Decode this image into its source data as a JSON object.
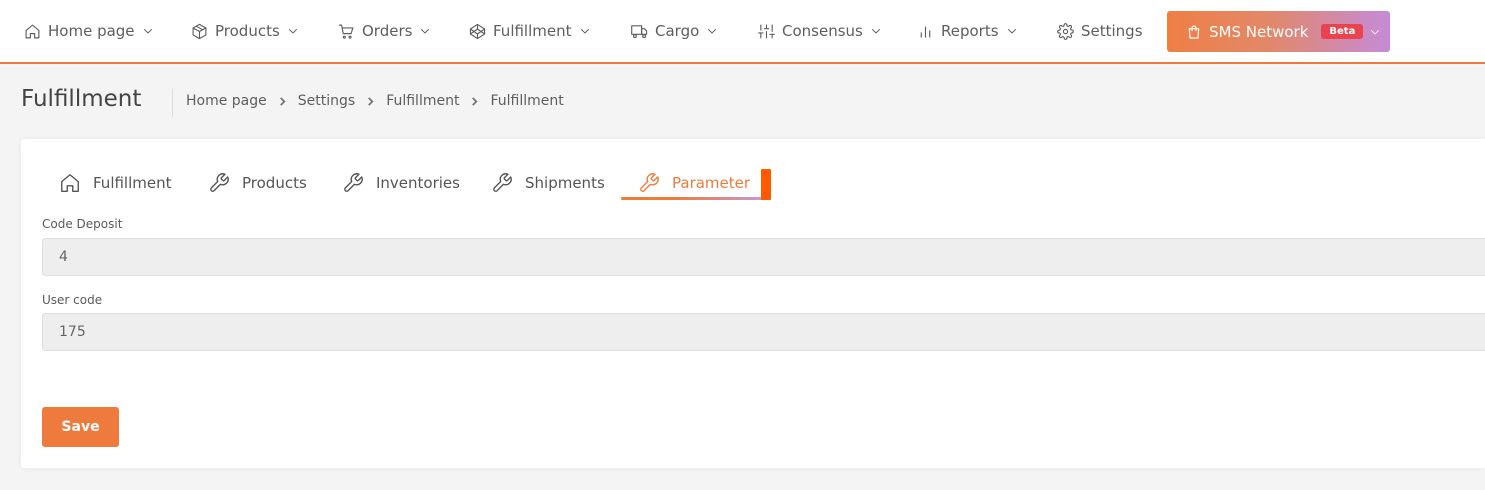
{
  "nav": {
    "items": [
      {
        "label": "Home page",
        "icon": "home-icon"
      },
      {
        "label": "Products",
        "icon": "box-icon"
      },
      {
        "label": "Orders",
        "icon": "cart-icon"
      },
      {
        "label": "Fulfillment",
        "icon": "codepen-icon"
      },
      {
        "label": "Cargo",
        "icon": "truck-icon"
      },
      {
        "label": "Consensus",
        "icon": "sliders-icon"
      },
      {
        "label": "Reports",
        "icon": "bar-chart-icon"
      },
      {
        "label": "Settings",
        "icon": "gear-icon"
      }
    ],
    "sms": {
      "label": "SMS Network",
      "badge": "Beta",
      "icon": "shopping-bag-icon"
    }
  },
  "page": {
    "title": "Fulfillment",
    "breadcrumb": [
      "Home page",
      "Settings",
      "Fulfillment",
      "Fulfillment"
    ]
  },
  "tabs": [
    {
      "label": "Fulfillment",
      "icon": "home-icon"
    },
    {
      "label": "Products",
      "icon": "wrench-icon"
    },
    {
      "label": "Inventories",
      "icon": "wrench-icon"
    },
    {
      "label": "Shipments",
      "icon": "wrench-icon"
    },
    {
      "label": "Parameter",
      "icon": "wrench-icon",
      "active": true
    }
  ],
  "form": {
    "code_deposit": {
      "label": "Code Deposit",
      "value": "4"
    },
    "user_code": {
      "label": "User code",
      "value": "175"
    },
    "save_label": "Save"
  },
  "colors": {
    "accent": "#ee7a3d",
    "field_bg": "#eeeeee",
    "beta_badge": "#e8434f",
    "marker": "#ff5a00"
  }
}
